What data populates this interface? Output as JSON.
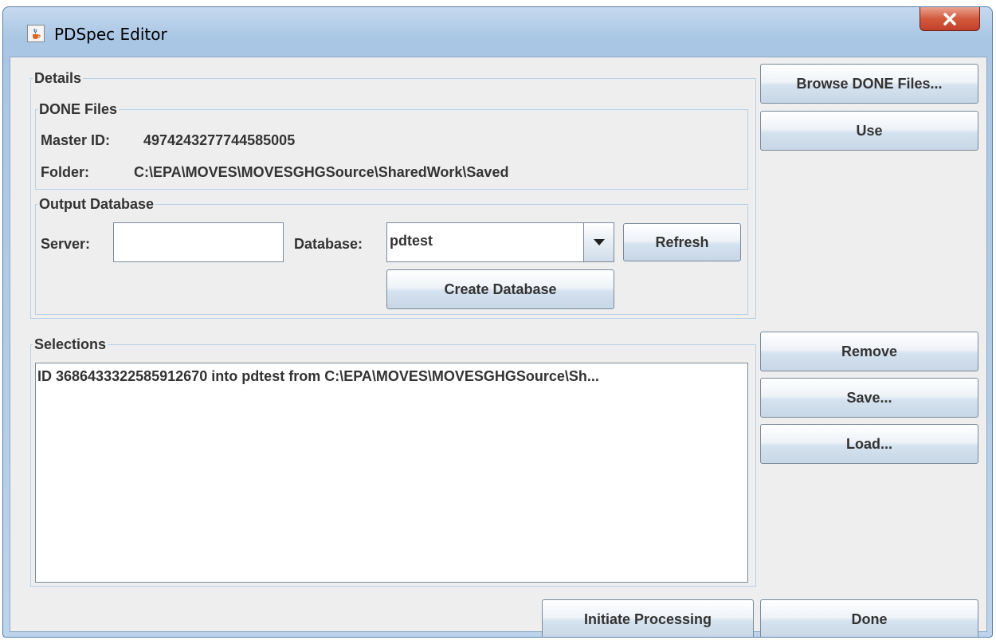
{
  "window": {
    "title": "PDSpec Editor"
  },
  "details": {
    "title": "Details",
    "done_files": {
      "title": "DONE Files",
      "master_id_label": "Master ID:",
      "master_id_value": "4974243277744585005",
      "folder_label": "Folder:",
      "folder_value": "C:\\EPA\\MOVES\\MOVESGHGSource\\SharedWork\\Saved"
    },
    "output_database": {
      "title": "Output Database",
      "server_label": "Server:",
      "server_value": "",
      "database_label": "Database:",
      "database_value": "pdtest",
      "refresh_label": "Refresh",
      "create_database_label": "Create Database"
    }
  },
  "selections": {
    "title": "Selections",
    "items": [
      "ID 3686433322585912670 into pdtest from C:\\EPA\\MOVES\\MOVESGHGSource\\Sh..."
    ]
  },
  "buttons": {
    "browse": "Browse DONE Files...",
    "use": "Use",
    "remove": "Remove",
    "save": "Save...",
    "load": "Load...",
    "initiate": "Initiate Processing",
    "done": "Done"
  },
  "icons": {
    "app": "java-cup-icon",
    "close": "close-icon",
    "dropdown": "chevron-down-icon"
  }
}
